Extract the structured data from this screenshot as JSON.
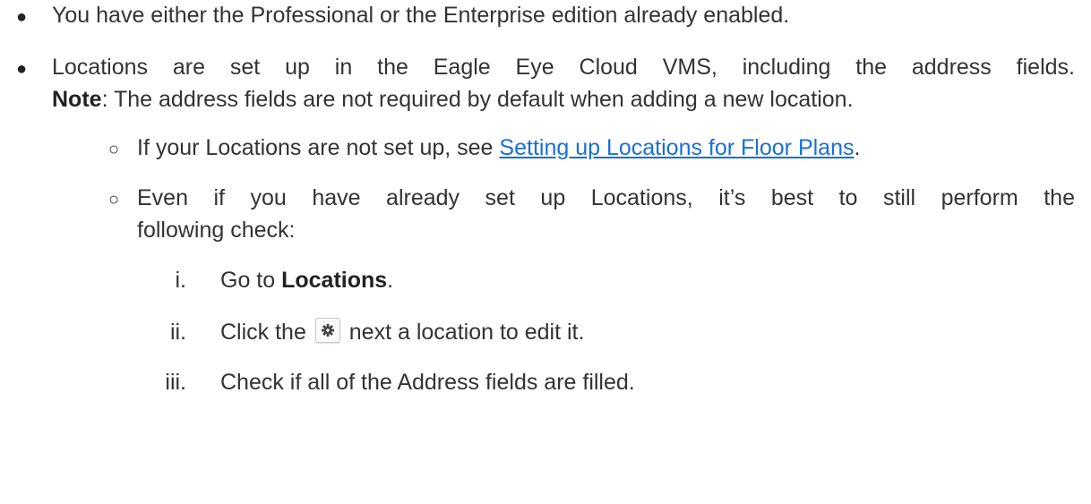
{
  "items": [
    {
      "marker": "●",
      "text": "You have either the Professional or the Enterprise edition already enabled."
    },
    {
      "marker": "●",
      "line1": "Locations are set up in the Eagle Eye Cloud VMS, including the address fields.",
      "note_label": "Note",
      "note_text": ": The address fields are not required by default when adding a new location.",
      "sub_items": [
        {
          "marker": "○",
          "prefix": "If your Locations are not set up, see ",
          "link_text": "Setting up Locations for Floor Plans",
          "suffix": "."
        },
        {
          "marker": "○",
          "line1": "Even if you have already set up Locations, it’s best to still perform the",
          "line2": "following check:",
          "steps": [
            {
              "numeral": "i.",
              "prefix": "Go to ",
              "bold": "Locations",
              "suffix": "."
            },
            {
              "numeral": "ii.",
              "prefix": "Click the",
              "icon": "gear-icon",
              "suffix": "next a location to edit it."
            },
            {
              "numeral": "iii.",
              "text": "Check if all of the Address fields are filled."
            }
          ]
        }
      ]
    }
  ]
}
